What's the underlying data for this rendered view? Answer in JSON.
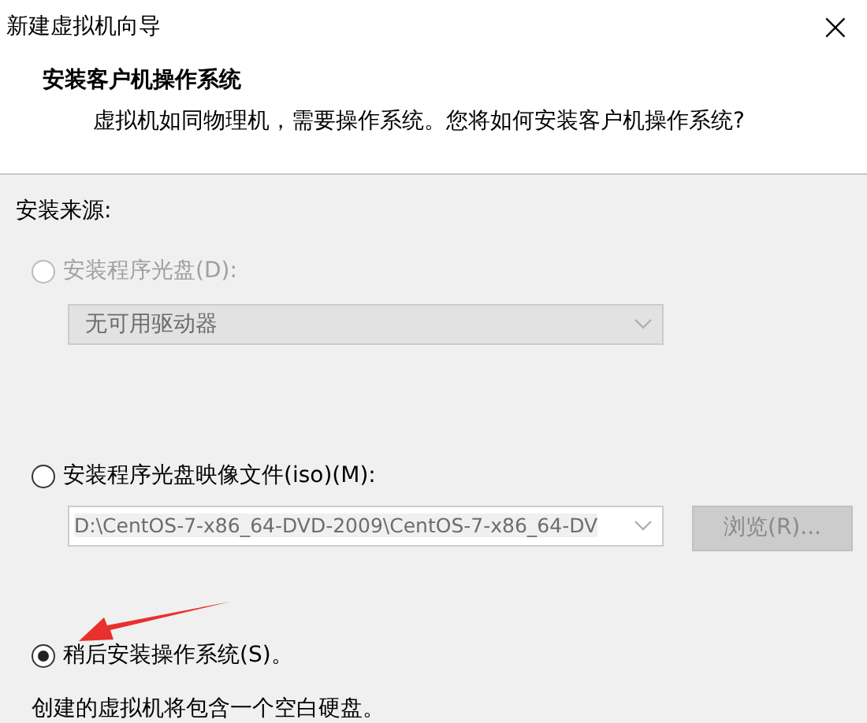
{
  "window": {
    "title": "新建虚拟机向导",
    "close": "×"
  },
  "header": {
    "title": "安装客户机操作系统",
    "subtitle": "虚拟机如同物理机，需要操作系统。您将如何安装客户机操作系统?"
  },
  "source_label": "安装来源:",
  "options": [
    {
      "kind": "drive",
      "label": "安装程序光盘(D):",
      "selected": false,
      "disabled": true,
      "dropdown": {
        "value": "无可用驱动器",
        "disabled": true
      }
    },
    {
      "kind": "iso",
      "label": "安装程序光盘映像文件(iso)(M):",
      "selected": false,
      "disabled": false,
      "path": {
        "value": "D:\\CentOS-7-x86_64-DVD-2009\\CentOS-7-x86_64-DV",
        "disabled": true
      },
      "browse": {
        "label": "浏览(R)...",
        "disabled": true
      }
    },
    {
      "kind": "later",
      "label": "稍后安装操作系统(S)。",
      "selected": true,
      "disabled": false,
      "note": "创建的虚拟机将包含一个空白硬盘。"
    }
  ]
}
